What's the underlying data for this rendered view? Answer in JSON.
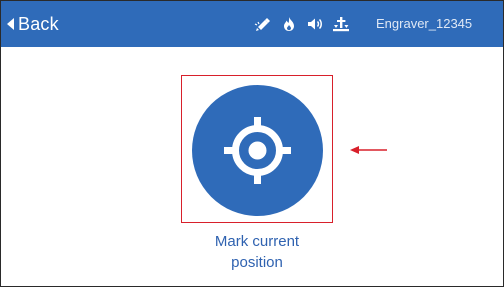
{
  "header": {
    "back_label": "Back",
    "device_name": "Engraver_12345",
    "status_icons": [
      "laser-pen-icon",
      "fire-icon",
      "speaker-icon",
      "anchor-icon"
    ]
  },
  "main": {
    "action_label_line1": "Mark current",
    "action_label_line2": "position",
    "action_icon": "crosshair-icon"
  },
  "colors": {
    "brand_blue": "#2f6bb9",
    "highlight_red": "#d8202b",
    "label_blue": "#2f62b0"
  }
}
